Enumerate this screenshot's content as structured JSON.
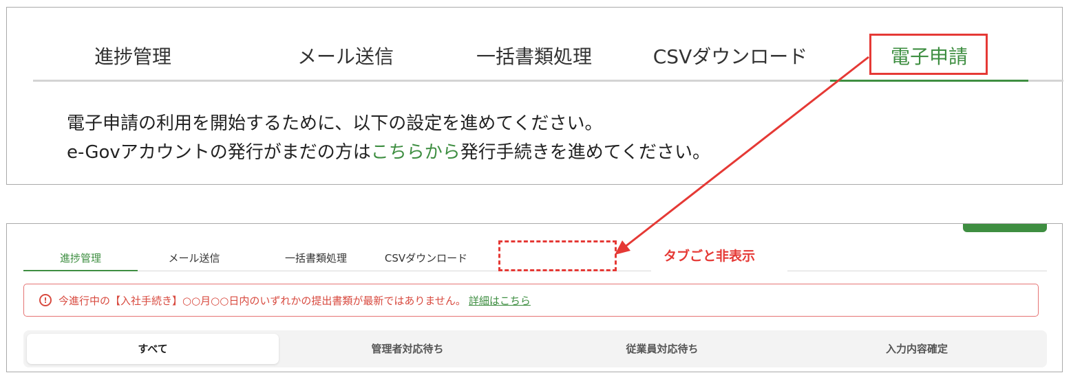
{
  "top": {
    "tabs": [
      {
        "label": "進捗管理"
      },
      {
        "label": "メール送信"
      },
      {
        "label": "一括書類処理"
      },
      {
        "label": "CSVダウンロード"
      },
      {
        "label": "電子申請"
      }
    ],
    "message_line1": "電子申請の利用を開始するために、以下の設定を進めてください。",
    "message_line2_prefix": "e-Govアカウントの発行がまだの方は",
    "message_line2_link": "こちらから",
    "message_line2_suffix": "発行手続きを進めてください。"
  },
  "bottom": {
    "tabs": [
      {
        "label": "進捗管理"
      },
      {
        "label": "メール送信"
      },
      {
        "label": "一括書類処理"
      },
      {
        "label": "CSVダウンロード"
      }
    ],
    "hidden_note": "タブごと非表示",
    "alert": {
      "icon": "!",
      "text": "今進行中の【入社手続き】○○月○○日内のいずれかの提出書類が最新ではありません。",
      "link": "詳細はこちら"
    },
    "segments": [
      {
        "label": "すべて"
      },
      {
        "label": "管理者対応待ち"
      },
      {
        "label": "従業員対応待ち"
      },
      {
        "label": "入力内容確定"
      }
    ]
  },
  "colors": {
    "accent_green": "#3e8e41",
    "annotation_red": "#e53935",
    "alert_red": "#d84a3f"
  }
}
